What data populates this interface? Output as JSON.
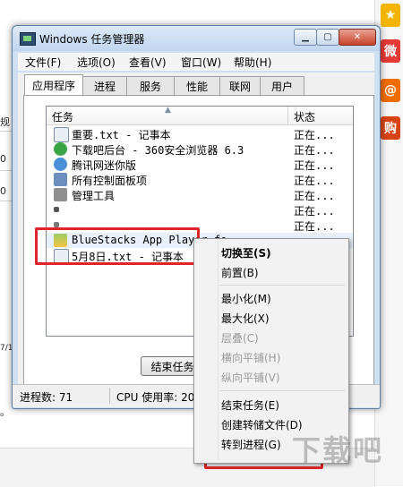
{
  "window": {
    "title": "Windows 任务管理器",
    "minimize_glyph": "▁",
    "maximize_glyph": "▢",
    "close_glyph": "✕"
  },
  "menu": [
    {
      "label": "文件(F)"
    },
    {
      "label": "选项(O)"
    },
    {
      "label": "查看(V)"
    },
    {
      "label": "窗口(W)"
    },
    {
      "label": "帮助(H)"
    }
  ],
  "tabs": [
    {
      "label": "应用程序",
      "active": true
    },
    {
      "label": "进程"
    },
    {
      "label": "服务"
    },
    {
      "label": "性能"
    },
    {
      "label": "联网"
    },
    {
      "label": "用户"
    }
  ],
  "columns": {
    "task": "任务",
    "status": "状态"
  },
  "tasks": [
    {
      "name": "重要.txt - 记事本",
      "status": "正在...",
      "icon": "notepad-icon",
      "color": "#e9eef4"
    },
    {
      "name": "下载吧后台 - 360安全浏览器 6.3",
      "status": "正在...",
      "icon": "browser-icon",
      "color": "#3aa547"
    },
    {
      "name": "腾讯网迷你版",
      "status": "正在...",
      "icon": "qq-icon",
      "color": "#4a90d9"
    },
    {
      "name": "所有控制面板项",
      "status": "正在...",
      "icon": "control-panel-icon",
      "color": "#6d8fbf"
    },
    {
      "name": "管理工具",
      "status": "正在...",
      "icon": "admin-tools-icon",
      "color": "#8f8f8f"
    },
    {
      "name": "",
      "status": "正在...",
      "icon": "app-icon",
      "color": "#555555"
    },
    {
      "name": "",
      "status": "正在...",
      "icon": "app-icon",
      "color": "#777777"
    },
    {
      "name": "BlueStacks App Player fo",
      "status": "",
      "icon": "bluestacks-icon",
      "color": "#7cb342"
    },
    {
      "name": "5月8日.txt - 记事本",
      "status": "",
      "icon": "notepad-icon",
      "color": "#e9eef4"
    }
  ],
  "buttons": {
    "end_task": "结束任务 (E"
  },
  "statusbar": {
    "processes": "进程数: 71",
    "cpu": "CPU 使用率: 20"
  },
  "context_menu": {
    "items": [
      {
        "label": "切换至(S)",
        "bold": true
      },
      {
        "label": "前置(B)"
      },
      {
        "label": "最小化(M)"
      },
      {
        "label": "最大化(X)"
      },
      {
        "label": "层叠(C)",
        "disabled": true
      },
      {
        "label": "横向平铺(H)",
        "disabled": true
      },
      {
        "label": "纵向平铺(V)",
        "disabled": true
      },
      {
        "label": "结束任务(E)"
      },
      {
        "label": "创建转储文件(D)"
      },
      {
        "label": "转到进程(G)"
      }
    ]
  },
  "background": {
    "left_fragments": [
      "规",
      "0",
      "0",
      "7/1"
    ],
    "bottom_text": "。"
  },
  "watermark": "下载吧",
  "colors": {
    "highlight": "#e0242a",
    "accent_window": "#cfe0f3"
  }
}
